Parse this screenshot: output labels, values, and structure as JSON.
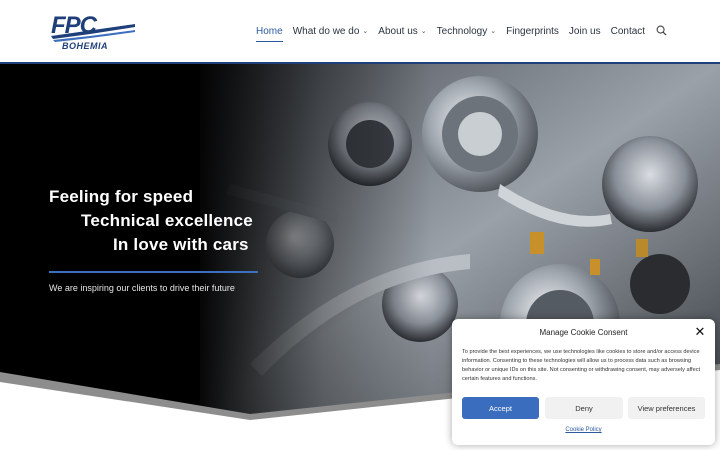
{
  "logo": {
    "main": "FPC",
    "sub": "BOHEMIA"
  },
  "nav": {
    "items": [
      {
        "label": "Home",
        "has_dropdown": false,
        "active": true
      },
      {
        "label": "What do we do",
        "has_dropdown": true
      },
      {
        "label": "About us",
        "has_dropdown": true
      },
      {
        "label": "Technology",
        "has_dropdown": true
      },
      {
        "label": "Fingerprints",
        "has_dropdown": false
      },
      {
        "label": "Join us",
        "has_dropdown": false
      },
      {
        "label": "Contact",
        "has_dropdown": false
      }
    ],
    "chevron": "⌄",
    "search_icon": "search-icon"
  },
  "hero": {
    "line1": "Feeling for speed",
    "line2": "Technical excellence",
    "line3": "In love with cars",
    "subtitle": "We are inspiring our clients to drive their future"
  },
  "cookie": {
    "title": "Manage Cookie Consent",
    "close": "✕",
    "body": "To provide the best experiences, we use technologies like cookies to store and/or access device information. Consenting to these technologies will allow us to process data such as browsing behavior or unique IDs on this site. Not consenting or withdrawing consent, may adversely affect certain features and functions.",
    "accept": "Accept",
    "deny": "Deny",
    "preferences": "View preferences",
    "policy": "Cookie Policy"
  },
  "colors": {
    "accent": "#3a6dbd",
    "nav_active": "#2c5aa0",
    "header_rule": "#1f3f7a"
  }
}
